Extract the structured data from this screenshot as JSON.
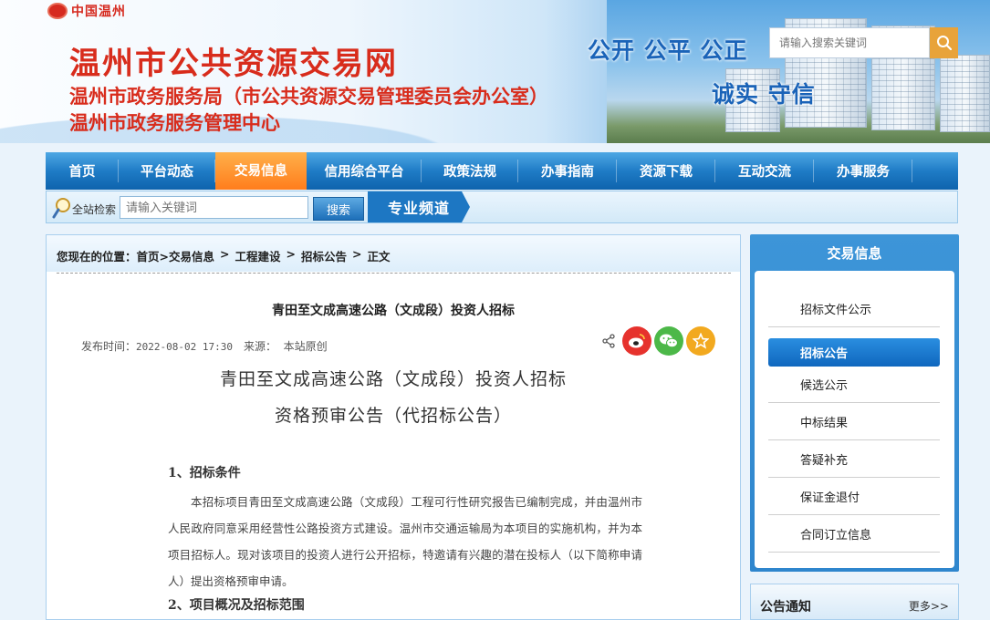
{
  "header": {
    "logo_text": "中国温州",
    "site_title": "温州市公共资源交易网",
    "subtitle_1": "温州市政务服务局（市公共资源交易管理委员会办公室）",
    "subtitle_2": "温州市政务服务管理中心",
    "slogan_1": "公开 公平 公正",
    "slogan_2": "诚实 守信",
    "search_placeholder": "请输入搜索关键词"
  },
  "nav": {
    "items": [
      {
        "label": "首页"
      },
      {
        "label": "平台动态"
      },
      {
        "label": "交易信息",
        "active": true
      },
      {
        "label": "信用综合平台"
      },
      {
        "label": "政策法规"
      },
      {
        "label": "办事指南"
      },
      {
        "label": "资源下载"
      },
      {
        "label": "互动交流"
      },
      {
        "label": "办事服务"
      }
    ]
  },
  "searchbar": {
    "label": "全站检索",
    "placeholder": "请输入关键词",
    "button": "搜索",
    "channel": "专业频道"
  },
  "breadcrumb": {
    "prefix": "您现在的位置：",
    "home": "首页",
    "l1": ">交易信息",
    "l2": "工程建设",
    "l3": "招标公告",
    "l4": "正文",
    "sep": ">"
  },
  "article": {
    "title": "青田至文成高速公路（文成段）投资人招标",
    "publish_label": "发布时间：",
    "publish_time": "2022-08-02 17:30",
    "source_label": "来源：",
    "source_value": "本站原创",
    "heading_1": "青田至文成高速公路（文成段）投资人招标",
    "heading_2": "资格预审公告（代招标公告）",
    "section_1": "1、招标条件",
    "paragraph_1": "本招标项目青田至文成高速公路（文成段）工程可行性研究报告已编制完成，并由温州市人民政府同意采用经营性公路投资方式建设。温州市交通运输局为本项目的实施机构，并为本项目招标人。现对该项目的投资人进行公开招标，特邀请有兴趣的潜在投标人（以下简称申请人）提出资格预审申请。",
    "section_2": "2、项目概况及招标范围"
  },
  "share": {
    "colors": {
      "weibo": "#e6322d",
      "wechat": "#4cb848",
      "favorite": "#f2a91f"
    }
  },
  "sidebar": {
    "title": "交易信息",
    "items": [
      {
        "label": "招标文件公示"
      },
      {
        "label": "招标公告",
        "active": true
      },
      {
        "label": "候选公示"
      },
      {
        "label": "中标结果"
      },
      {
        "label": "答疑补充"
      },
      {
        "label": "保证金退付"
      },
      {
        "label": "合同订立信息"
      }
    ]
  },
  "notice": {
    "title": "公告通知",
    "more": "更多>>"
  }
}
